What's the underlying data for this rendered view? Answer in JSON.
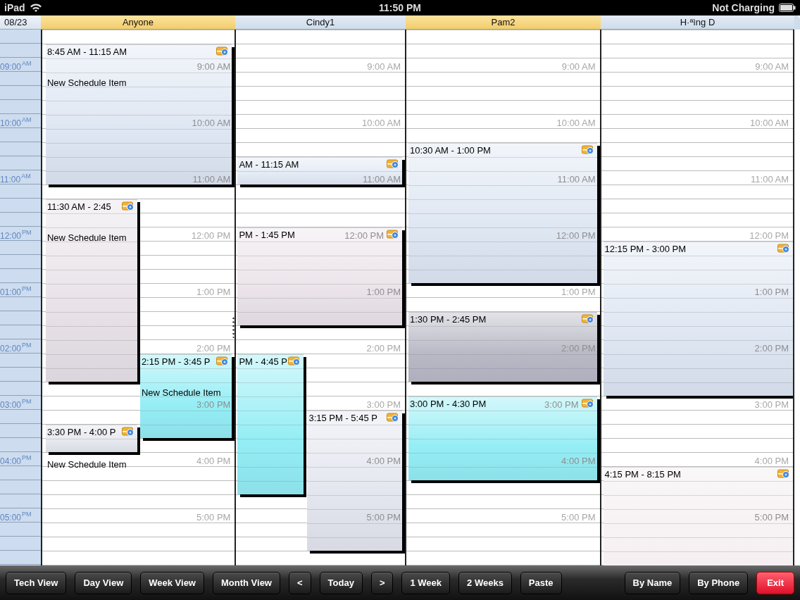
{
  "status_bar": {
    "device": "iPad",
    "time": "11:50 PM",
    "battery_text": "Not Charging"
  },
  "date": "08/23",
  "time_labels": [
    "09:00$^{AM}$",
    "10:00$^{AM}$",
    "11:00$^{AM}$",
    "12:00$^{PM}$",
    "01:00$^{PM}$",
    "02:00$^{PM}$",
    "03:00$^{PM}$",
    "04:00$^{PM}$",
    "05:00$^{PM}$"
  ],
  "columns": [
    {
      "name": "Anyone",
      "highlighted": true,
      "hour_labels": [
        "9:00 AM",
        "10:00 AM",
        "11:00 AM",
        "12:00 PM",
        "1:00 PM",
        "2:00 PM",
        "3:00 PM",
        "4:00 PM",
        "5:00 PM"
      ],
      "events": [
        {
          "time": "8:45 AM - 11:15 AM",
          "title": "New Schedule Item",
          "color": "#dfe7f3"
        },
        {
          "time": "11:30 AM - 2:45",
          "title": "New Schedule Item",
          "color": "#e8e2e8"
        },
        {
          "time": "2:15 PM - 3:45 P",
          "title": "New Schedule Item",
          "color": "#95eef5"
        },
        {
          "time": "3:30 PM - 4:00 P",
          "title": "New Schedule Item",
          "color": "#e6e8ef"
        }
      ]
    },
    {
      "name": "Cindy1",
      "highlighted": false,
      "hour_labels": [
        "9:00 AM",
        "10:00 AM",
        "11:00 AM",
        "12:00 PM",
        "1:00 PM",
        "2:00 PM",
        "3:00 PM",
        "4:00 PM",
        "5:00 PM"
      ],
      "events": [
        {
          "time": "AM - 11:15 AM",
          "color": "#e4ebf5"
        },
        {
          "time": "PM - 1:45 PM",
          "color": "#ece4ea"
        },
        {
          "time": "PM - 4:45 P",
          "color": "#95eef5"
        },
        {
          "time": "3:15 PM - 5:45 P",
          "color": "#e4e6ef"
        }
      ]
    },
    {
      "name": "Pam2",
      "highlighted": true,
      "hour_labels": [
        "9:00 AM",
        "10:00 AM",
        "11:00 AM",
        "12:00 PM",
        "1:00 PM",
        "2:00 PM",
        "3:00 PM",
        "4:00 PM",
        "5:00 PM"
      ],
      "events": [
        {
          "time": "10:30 AM - 1:00 PM",
          "color": "#dfe7f3"
        },
        {
          "time": "1:30 PM - 2:45 PM",
          "color": "#b9b9c6"
        },
        {
          "time": "3:00 PM - 4:30 PM",
          "color": "#95eef5"
        }
      ]
    },
    {
      "name": "H·ªìng D",
      "highlighted": false,
      "hour_labels": [
        "9:00 AM",
        "10:00 AM",
        "11:00 AM",
        "12:00 PM",
        "1:00 PM",
        "2:00 PM",
        "3:00 PM",
        "4:00 PM",
        "5:00 PM"
      ],
      "events": [
        {
          "time": "12:15 PM - 3:00 PM",
          "color": "#dfe7f3"
        },
        {
          "time": "4:15 PM - 8:15 PM",
          "color": "#f3ecef"
        }
      ]
    }
  ],
  "toolbar_left": [
    {
      "label": "Tech View"
    },
    {
      "label": "Day View"
    },
    {
      "label": "Week View"
    },
    {
      "label": "Month View"
    },
    {
      "label": "<"
    },
    {
      "label": "Today"
    },
    {
      "label": ">"
    },
    {
      "label": "1 Week"
    },
    {
      "label": "2 Weeks"
    },
    {
      "label": "Paste"
    }
  ],
  "toolbar_right": [
    {
      "label": "By Name",
      "kind": "normal"
    },
    {
      "label": "By Phone",
      "kind": "normal"
    },
    {
      "label": "Exit",
      "kind": "danger"
    }
  ]
}
